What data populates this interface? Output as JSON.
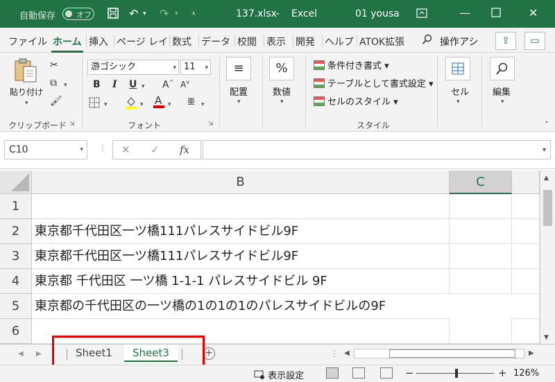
{
  "titlebar": {
    "autosave_label": "自動保存",
    "autosave_state": "オフ",
    "filename": "137.xlsx",
    "app_name": "Excel",
    "user": "01 yousa"
  },
  "tabs": [
    "ファイル",
    "ホーム",
    "挿入",
    "ページ レイ",
    "数式",
    "データ",
    "校閲",
    "表示",
    "開発",
    "ヘルプ",
    "ATOK拡張"
  ],
  "tell_me": "操作アシ",
  "ribbon": {
    "clipboard": {
      "paste_label": "貼り付け",
      "group_label": "クリップボード"
    },
    "font": {
      "font_name": "游ゴシック",
      "font_size": "11",
      "group_label": "フォント"
    },
    "alignment": {
      "label": "配置"
    },
    "number": {
      "label": "数値",
      "symbol": "%"
    },
    "styles": {
      "conditional": "条件付き書式 ▾",
      "as_table": "テーブルとして書式設定 ▾",
      "cell_styles": "セルのスタイル ▾",
      "group_label": "スタイル"
    },
    "cells": {
      "label": "セル"
    },
    "editing": {
      "label": "編集"
    }
  },
  "formula_bar": {
    "name_box": "C10",
    "fx": "fx",
    "value": ""
  },
  "grid": {
    "columns": [
      "B",
      "C"
    ],
    "selected_column": "C",
    "rows": [
      {
        "num": "1",
        "b": ""
      },
      {
        "num": "2",
        "b": "東京都千代田区一ツ橋111パレスサイドビル9F"
      },
      {
        "num": "3",
        "b": "東京都千代田区一ツ橋111パレスサイドビル9F"
      },
      {
        "num": "4",
        "b": "東京都 千代田区 一ツ橋 1-1-1 パレスサイドビル 9F"
      },
      {
        "num": "5",
        "b": "東京都の千代田区の一ツ橋の1の1の1のパレスサイドビルの9F"
      },
      {
        "num": "6",
        "b": ""
      }
    ]
  },
  "sheets": {
    "items": [
      "Sheet1",
      "Sheet3"
    ],
    "active": "Sheet3",
    "add_symbol": "+"
  },
  "statusbar": {
    "display_settings": "表示設定",
    "zoom_minus": "−",
    "zoom_plus": "+",
    "zoom": "126%",
    "zoom_fraction": 0.5
  },
  "colors": {
    "excel_green": "#217346",
    "highlight_red": "#e00000"
  }
}
